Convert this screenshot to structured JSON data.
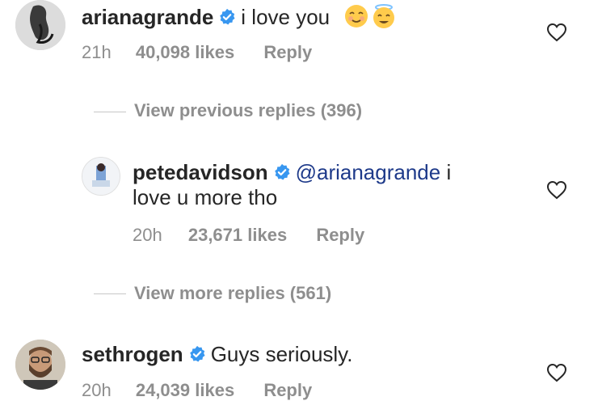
{
  "comments": [
    {
      "username": "arianagrande",
      "text": "i love you",
      "emojis": [
        "smiling-face-emoji",
        "halo-face-emoji"
      ],
      "time": "21h",
      "likes": "40,098 likes",
      "reply": "Reply"
    },
    {
      "username": "petedavidson",
      "mention": "@arianagrande",
      "text_line1_suffix": " i",
      "text_line2": "love u more tho",
      "time": "20h",
      "likes": "23,671 likes",
      "reply": "Reply"
    },
    {
      "username": "sethrogen",
      "text": "Guys seriously.",
      "time": "20h",
      "likes": "24,039 likes",
      "reply": "Reply"
    }
  ],
  "view_previous": "View previous replies (396)",
  "view_more": "View more replies (561)",
  "colors": {
    "verified": "#3897f0",
    "mention": "#1e3a8a",
    "meta": "#8e8e8e"
  }
}
